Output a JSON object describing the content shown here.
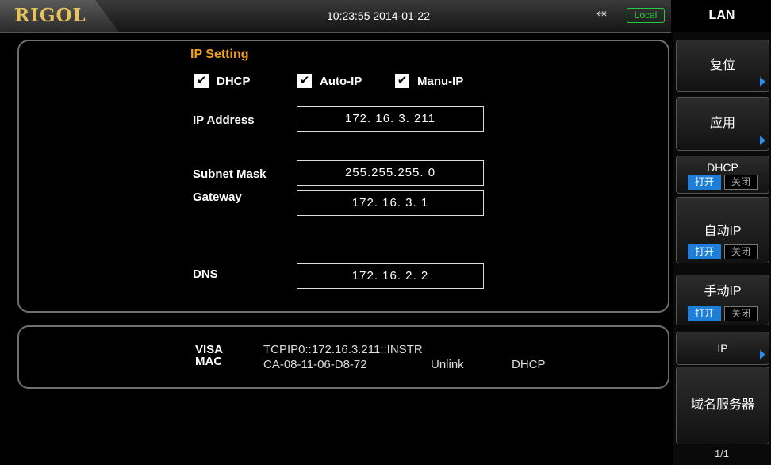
{
  "header": {
    "logo": "RIGOL",
    "datetime": "10:23:55 2014-01-22",
    "status_badge": "Local"
  },
  "ip_setting": {
    "title": "IP Setting",
    "checkboxes": [
      {
        "label": "DHCP",
        "checked": true
      },
      {
        "label": "Auto-IP",
        "checked": true
      },
      {
        "label": "Manu-IP",
        "checked": true
      }
    ],
    "fields": [
      {
        "label": "IP Address",
        "value": "172. 16. 3. 211"
      },
      {
        "label": "Subnet Mask",
        "value": "255.255.255. 0"
      },
      {
        "label": "Gateway",
        "value": "172. 16. 3. 1"
      },
      {
        "label": "DNS",
        "value": "172. 16. 2. 2"
      }
    ]
  },
  "info": {
    "visa_label": "VISA",
    "visa_value": "TCPIP0::172.16.3.211::INSTR",
    "mac_label": "MAC",
    "mac_value": "CA-08-11-06-D8-72",
    "link_status": "Unlink",
    "mode": "DHCP"
  },
  "sidebar": {
    "title": "LAN",
    "reset": "复位",
    "apply": "应用",
    "dhcp": {
      "label": "DHCP",
      "on": "打开",
      "off": "关闭"
    },
    "auto_ip": {
      "label": "自动IP",
      "on": "打开",
      "off": "关闭"
    },
    "manu_ip": {
      "label": "手动IP",
      "on": "打开",
      "off": "关闭"
    },
    "ip": "IP",
    "dns": "域名服务器",
    "page": "1/1"
  },
  "colors": {
    "accent_title": "#f0a020",
    "toggle_on": "#1f7fd8",
    "local_badge": "#27c93f",
    "logo": "#e8c25a"
  },
  "icons": {
    "usb": "usb-icon",
    "checkbox": "checkmark-icon",
    "more": "triangle-right-icon"
  }
}
